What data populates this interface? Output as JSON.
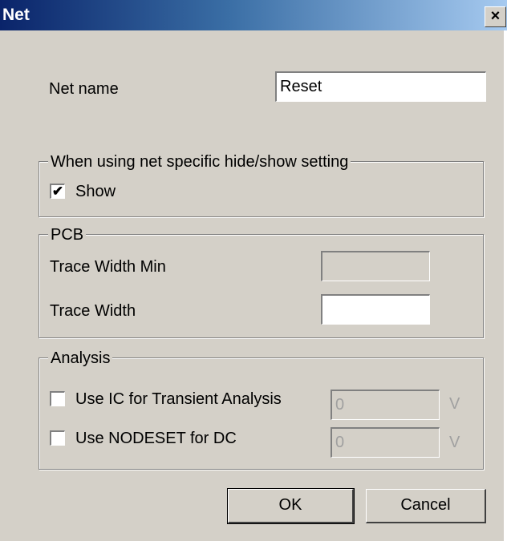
{
  "window": {
    "title": "Net",
    "close_glyph": "×"
  },
  "net_name": {
    "label": "Net name",
    "value": "Reset"
  },
  "visibility_group": {
    "title": "When using net specific hide/show setting",
    "show_checkbox": {
      "label": "Show",
      "checked": true,
      "mark": "✔"
    }
  },
  "pcb_group": {
    "title": "PCB",
    "trace_width_min": {
      "label": "Trace Width Min",
      "value": ""
    },
    "trace_width": {
      "label": "Trace Width",
      "value": ""
    }
  },
  "analysis_group": {
    "title": "Analysis",
    "ic_transient": {
      "label": "Use IC for Transient Analysis",
      "checked": false,
      "value": "0",
      "unit": "V"
    },
    "nodeset_dc": {
      "label": "Use NODESET for DC",
      "checked": false,
      "value": "0",
      "unit": "V"
    }
  },
  "buttons": {
    "ok": "OK",
    "cancel": "Cancel"
  }
}
